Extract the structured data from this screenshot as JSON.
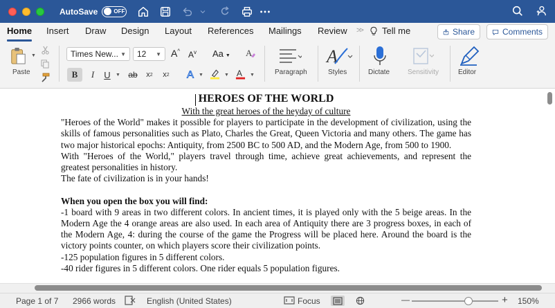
{
  "titlebar": {
    "autosave_label": "AutoSave",
    "autosave_state": "OFF"
  },
  "tabs": [
    {
      "label": "Home",
      "active": true
    },
    {
      "label": "Insert"
    },
    {
      "label": "Draw"
    },
    {
      "label": "Design"
    },
    {
      "label": "Layout"
    },
    {
      "label": "References"
    },
    {
      "label": "Mailings"
    },
    {
      "label": "Review"
    }
  ],
  "tellme": "Tell me",
  "share_label": "Share",
  "comments_label": "Comments",
  "ribbon": {
    "paste": "Paste",
    "font_name": "Times New...",
    "font_size": "12",
    "paragraph": "Paragraph",
    "styles": "Styles",
    "dictate": "Dictate",
    "sensitivity": "Sensitivity",
    "editor": "Editor",
    "bold": "B",
    "italic": "I",
    "underline": "U",
    "strike": "ab",
    "change_case": "Aa"
  },
  "document": {
    "title": "HEROES OF THE WORLD",
    "subtitle": "With the great heroes of the heyday of culture",
    "p1": "\"Heroes of the World\" makes it possible for players to participate in the development of civilization, using the skills of famous personalities such as Plato, Charles the Great, Queen Victoria and many others. The game has two major historical epochs: Antiquity, from 2500 BC to 500 AD, and the Modern Age, from 500 to 1900.",
    "p2": "With \"Heroes of the World,\" players travel through time, achieve great achievements, and represent the greatest personalities in history.",
    "p3": "The fate of civilization is in your hands!",
    "heading": "When you open the box you will find:",
    "p4": "-1 board with 9 areas in two different colors. In ancient times, it is played only with the 5 beige areas. In the Modern Age the 4 orange areas are also used. In each area of Antiquity there are 3 progress boxes, in each of the Modern Age, 4: during the course of the game the Progress will be placed here. Around the board is the victory points counter, on which players score their civilization points.",
    "p5": "-125 population figures in 5 different colors.",
    "p6": "-40 rider figures in 5 different colors. One rider equals 5 population figures."
  },
  "status": {
    "page": "Page 1 of 7",
    "words": "2966 words",
    "language": "English (United States)",
    "focus": "Focus",
    "zoom": "150%",
    "zoom_minus": "—",
    "zoom_plus": "+"
  },
  "colors": {
    "titlebar": "#2b5798",
    "highlight": "#ffeb3b",
    "font_color": "#e02020"
  }
}
